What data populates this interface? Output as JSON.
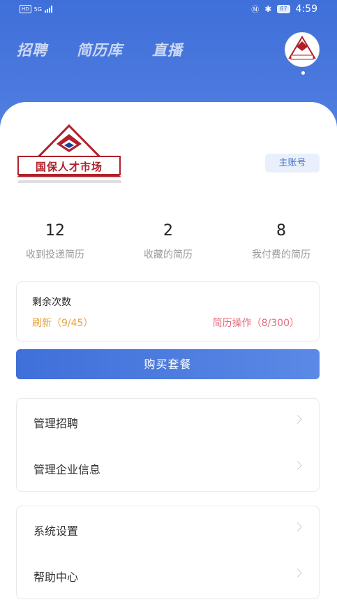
{
  "status_bar": {
    "left_badge": "HD",
    "network": "5G",
    "battery": "87",
    "time": "4:59"
  },
  "nav": {
    "tabs": [
      "招聘",
      "简历库",
      "直播"
    ]
  },
  "avatar": {
    "icon": "company-logo-avatar"
  },
  "company": {
    "logo_text": "国保人才市场",
    "account_type": "主账号"
  },
  "stats": [
    {
      "value": "12",
      "label": "收到投递简历"
    },
    {
      "value": "2",
      "label": "收藏的简历"
    },
    {
      "value": "8",
      "label": "我付费的简历"
    }
  ],
  "remaining": {
    "title": "剩余次数",
    "refresh": "刷新（9/45）",
    "resume_ops": "简历操作（8/300）",
    "colors": {
      "refresh": "#e6a23c",
      "ops": "#e36b7a"
    }
  },
  "buy_button": "购买套餐",
  "menu_group_1": [
    {
      "label": "管理招聘"
    },
    {
      "label": "管理企业信息"
    }
  ],
  "menu_group_2": [
    {
      "label": "系统设置"
    },
    {
      "label": "帮助中心"
    }
  ],
  "colors": {
    "primary": "#3f6fd9"
  }
}
